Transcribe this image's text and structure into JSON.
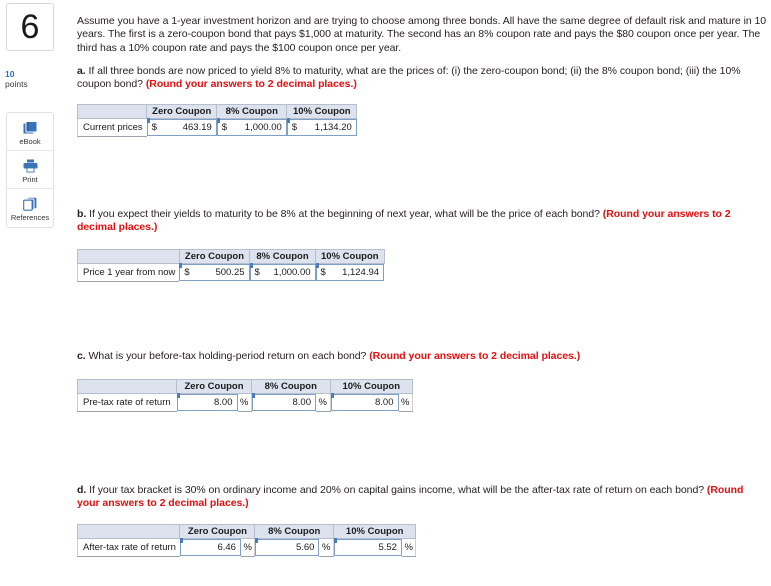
{
  "question": {
    "number": "6",
    "points_value": "10",
    "points_label": "points"
  },
  "tools": [
    {
      "id": "ebook",
      "label": "eBook",
      "icon": "book-icon"
    },
    {
      "id": "print",
      "label": "Print",
      "icon": "printer-icon"
    },
    {
      "id": "references",
      "label": "References",
      "icon": "copy-pages-icon"
    }
  ],
  "prompt": {
    "line1": "Assume you have a 1-year investment horizon and are trying to choose among three bonds. All have the same degree of default risk",
    "line2": "and mature in 10 years. The first is a zero-coupon bond that pays $1,000 at maturity. The second has an 8% coupon rate and pays the",
    "line3": "$80 coupon once per year. The third has a 10% coupon rate and pays the $100 coupon once per year."
  },
  "parts": {
    "a": {
      "letter": "a.",
      "text_line1": "If all three bonds are now priced to yield 8% to maturity, what are the prices of: (i) the zero-coupon bond; (ii) the 8% coupon bond; (iii)",
      "text_line2": "the 10% coupon bond?",
      "instruction": "(Round your answers to 2 decimal places.)",
      "table": {
        "headers": [
          "",
          "Zero Coupon",
          "8% Coupon",
          "10% Coupon"
        ],
        "row_label": "Current prices",
        "currency": "$",
        "values": [
          "463.19",
          "1,000.00",
          "1,134.20"
        ]
      }
    },
    "b": {
      "letter": "b.",
      "text_line1": "If you expect their yields to maturity to be 8% at the beginning of next year, what will be the price of each bond?",
      "instruction_line1": "(Round your",
      "instruction_line2": "answers to 2 decimal places.)",
      "table": {
        "headers": [
          "",
          "Zero Coupon",
          "8% Coupon",
          "10% Coupon"
        ],
        "row_label": "Price 1 year from now",
        "currency": "$",
        "values": [
          "500.25",
          "1,000.00",
          "1,124.94"
        ]
      }
    },
    "c": {
      "letter": "c.",
      "text_line1": "What is your before-tax holding-period return on each bond?",
      "instruction": "(Round your answers to 2 decimal places.)",
      "table": {
        "headers": [
          "",
          "Zero Coupon",
          "8% Coupon",
          "10% Coupon"
        ],
        "row_label": "Pre-tax rate of return",
        "unit": "%",
        "values": [
          "8.00",
          "8.00",
          "8.00"
        ]
      }
    },
    "d": {
      "letter": "d.",
      "text_line1": "If your tax bracket is 30% on ordinary income and 20% on capital gains income, what will be the after-tax rate of return on each",
      "text_line2": "bond?",
      "instruction": "(Round your answers to 2 decimal places.)",
      "table": {
        "headers": [
          "",
          "Zero Coupon",
          "8% Coupon",
          "10% Coupon"
        ],
        "row_label": "After-tax rate of return",
        "unit": "%",
        "values": [
          "6.46",
          "5.60",
          "5.52"
        ]
      }
    }
  },
  "colors": {
    "header_fill": "#dde3ee",
    "input_border": "#7f9fc4",
    "instruction_red": "#e01010",
    "points_blue": "#2a6ebb",
    "icon_blue": "#3b73b9"
  }
}
